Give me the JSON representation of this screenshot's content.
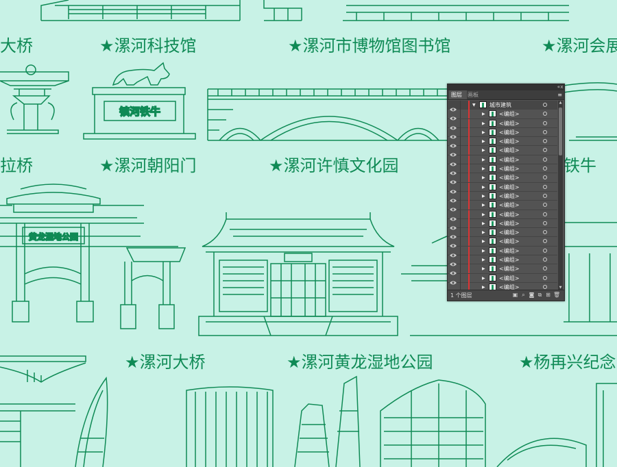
{
  "labels": {
    "l1": "大桥",
    "l2": "★漯河科技馆",
    "l3": "★漯河市博物馆图书馆",
    "l4": "★漯河会展",
    "l5": "拉桥",
    "l6": "★漯河朝阳门",
    "l7": "★漯河许慎文化园",
    "l8": "铁牛",
    "l9": "★漯河大桥",
    "l10": "★漯河黄龙湿地公园",
    "l11": "★杨再兴纪念"
  },
  "signs": {
    "cow_plaque": "镇河铁牛",
    "gate_plaque": "黄龙湿地公园"
  },
  "colors": {
    "background": "#c8f2e6",
    "line": "#0f8a55",
    "panel_bg": "#535353",
    "layer_color": "#d33"
  },
  "layers_panel": {
    "tab_layers": "图层",
    "tab_artboards": "画板",
    "collapse_icon": "«",
    "close_icon": "x",
    "menu_icon": "≡",
    "top_layer": {
      "name": "城市建筑"
    },
    "group_label": "<编组>",
    "group_count": 20,
    "footer_count": "1 个图层",
    "footer_icons": [
      "export-icon",
      "locate-icon",
      "make-mask-icon",
      "new-sublayer-icon",
      "new-layer-icon",
      "trash-icon"
    ]
  }
}
